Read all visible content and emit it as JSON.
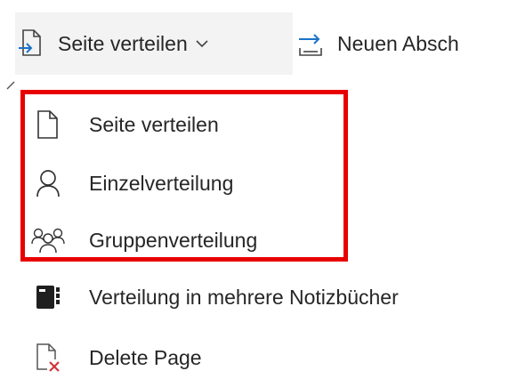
{
  "ribbon": {
    "distribute_label": "Seite verteilen",
    "distribute_icon": "page-distribute-icon",
    "chevron_icon": "chevron-down-icon",
    "new_section_label": "Neuen Absch",
    "new_section_icon": "new-section-icon"
  },
  "menu": {
    "items": [
      {
        "label": "Seite verteilen",
        "icon": "page-icon"
      },
      {
        "label": "Einzelverteilung",
        "icon": "person-icon"
      },
      {
        "label": "Gruppenverteilung",
        "icon": "group-icon"
      },
      {
        "label": "Verteilung in mehrere Notizbücher",
        "icon": "notebook-icon"
      },
      {
        "label": "Delete Page",
        "icon": "delete-page-icon"
      }
    ]
  },
  "colors": {
    "highlight": "#e80000",
    "accent_blue": "#1a73c8",
    "delete_red": "#d13438",
    "ribbon_active_bg": "#f3f3f3"
  }
}
